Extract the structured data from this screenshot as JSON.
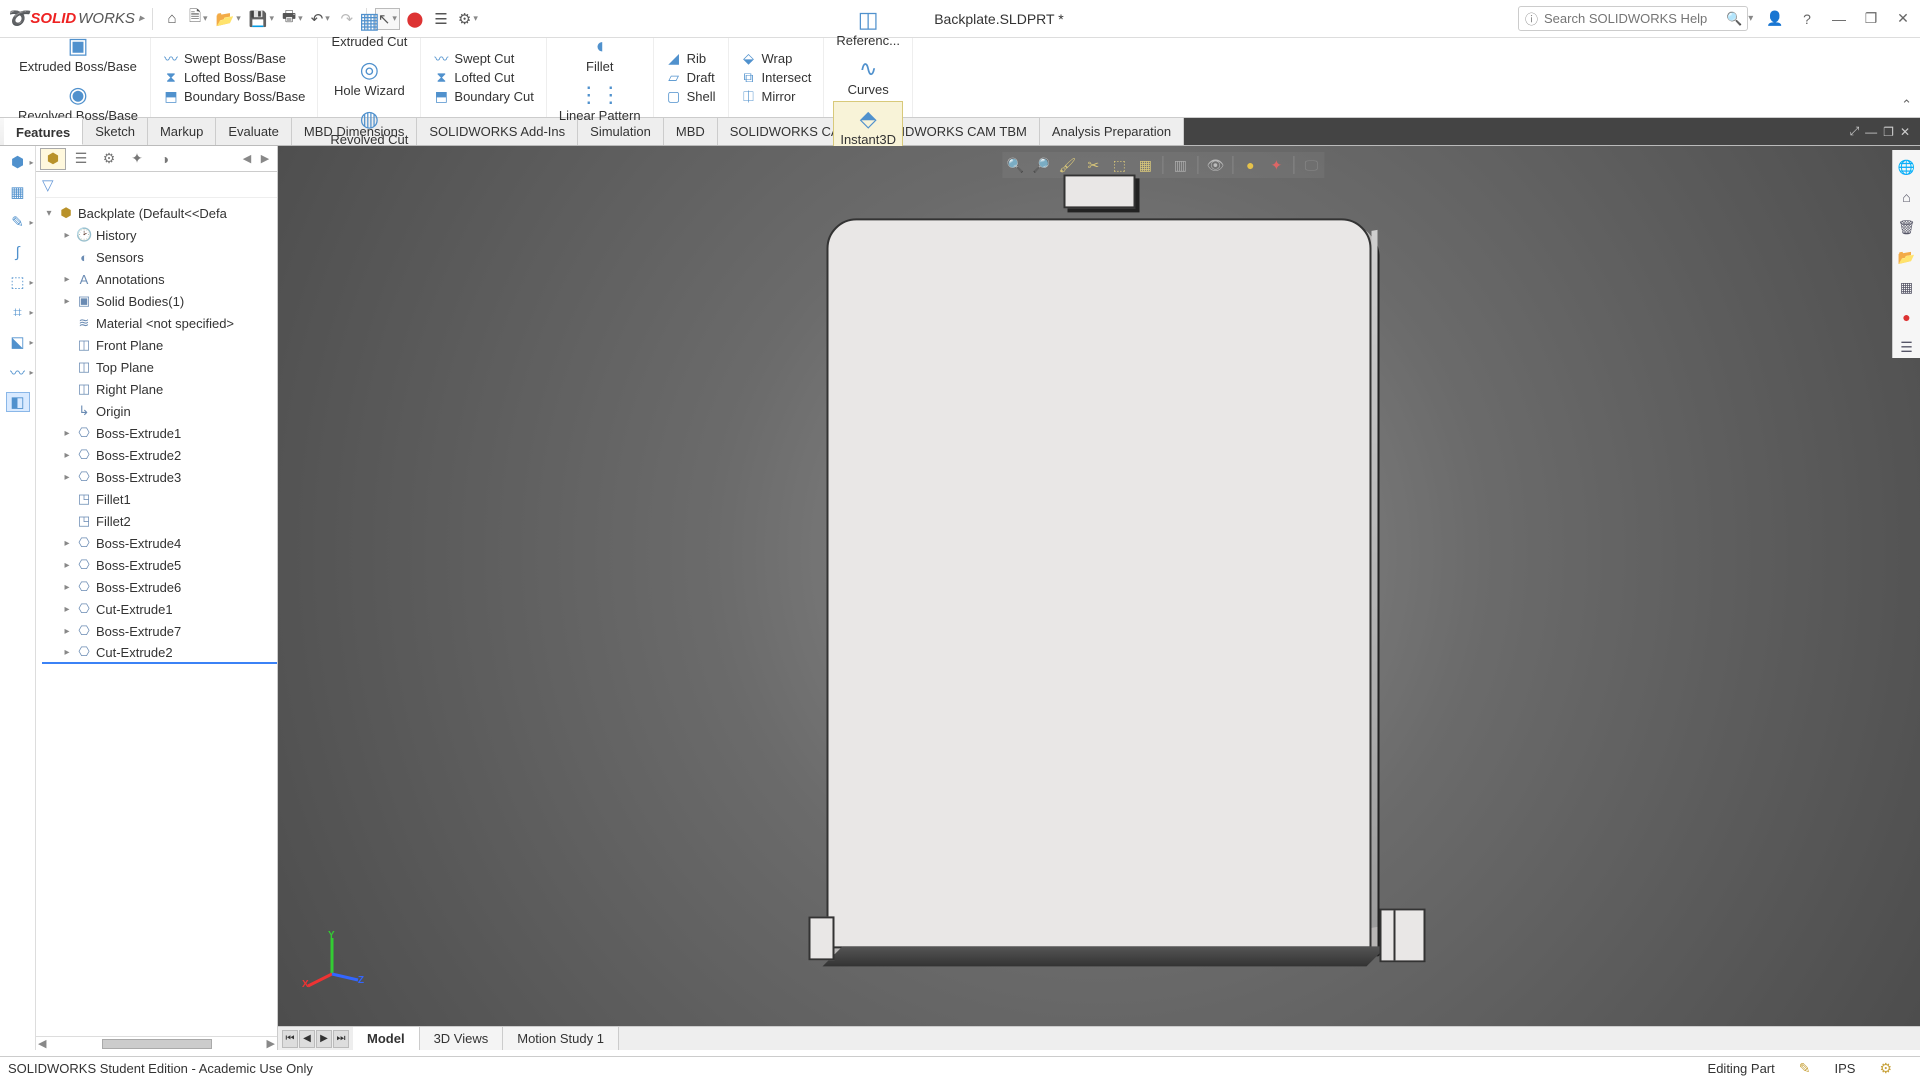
{
  "titlebar": {
    "brand_prefix": "SOLID",
    "brand_suffix": "WORKS",
    "doc_title": "Backplate.SLDPRT *",
    "search_placeholder": "Search SOLIDWORKS Help"
  },
  "ribbon": {
    "extruded_boss": "Extruded Boss/Base",
    "revolved_boss": "Revolved Boss/Base",
    "swept_boss": "Swept Boss/Base",
    "lofted_boss": "Lofted Boss/Base",
    "boundary_boss": "Boundary Boss/Base",
    "extruded_cut": "Extruded Cut",
    "hole_wizard": "Hole Wizard",
    "revolved_cut": "Revolved Cut",
    "swept_cut": "Swept Cut",
    "lofted_cut": "Lofted Cut",
    "boundary_cut": "Boundary Cut",
    "fillet": "Fillet",
    "linear_pattern": "Linear Pattern",
    "rib": "Rib",
    "draft": "Draft",
    "shell": "Shell",
    "wrap": "Wrap",
    "intersect": "Intersect",
    "mirror": "Mirror",
    "ref_geom": "Referenc...",
    "curves": "Curves",
    "instant3d": "Instant3D"
  },
  "tabs": {
    "items": [
      "Features",
      "Sketch",
      "Markup",
      "Evaluate",
      "MBD Dimensions",
      "SOLIDWORKS Add-Ins",
      "Simulation",
      "MBD",
      "SOLIDWORKS CAM",
      "SOLIDWORKS CAM TBM",
      "Analysis Preparation"
    ],
    "active_index": 0
  },
  "feature_tree": {
    "root": "Backplate  (Default<<Defa",
    "items": [
      {
        "label": "History",
        "icon": "🕑",
        "exp": "▸"
      },
      {
        "label": "Sensors",
        "icon": "◐",
        "exp": ""
      },
      {
        "label": "Annotations",
        "icon": "A",
        "exp": "▸"
      },
      {
        "label": "Solid Bodies(1)",
        "icon": "▣",
        "exp": "▸"
      },
      {
        "label": "Material <not specified>",
        "icon": "≋",
        "exp": ""
      },
      {
        "label": "Front Plane",
        "icon": "◫",
        "exp": ""
      },
      {
        "label": "Top Plane",
        "icon": "◫",
        "exp": ""
      },
      {
        "label": "Right Plane",
        "icon": "◫",
        "exp": ""
      },
      {
        "label": "Origin",
        "icon": "↳",
        "exp": ""
      },
      {
        "label": "Boss-Extrude1",
        "icon": "⎔",
        "exp": "▸"
      },
      {
        "label": "Boss-Extrude2",
        "icon": "⎔",
        "exp": "▸"
      },
      {
        "label": "Boss-Extrude3",
        "icon": "⎔",
        "exp": "▸"
      },
      {
        "label": "Fillet1",
        "icon": "◳",
        "exp": ""
      },
      {
        "label": "Fillet2",
        "icon": "◳",
        "exp": ""
      },
      {
        "label": "Boss-Extrude4",
        "icon": "⎔",
        "exp": "▸"
      },
      {
        "label": "Boss-Extrude5",
        "icon": "⎔",
        "exp": "▸"
      },
      {
        "label": "Boss-Extrude6",
        "icon": "⎔",
        "exp": "▸"
      },
      {
        "label": "Cut-Extrude1",
        "icon": "⎔",
        "exp": "▸"
      },
      {
        "label": "Boss-Extrude7",
        "icon": "⎔",
        "exp": "▸"
      },
      {
        "label": "Cut-Extrude2",
        "icon": "⎔",
        "exp": "▸"
      }
    ]
  },
  "bottom_tabs": {
    "items": [
      "Model",
      "3D Views",
      "Motion Study 1"
    ],
    "active_index": 0
  },
  "status": {
    "left": "SOLIDWORKS Student Edition - Academic Use Only",
    "mode": "Editing Part",
    "units": "IPS"
  },
  "triad": {
    "x": "X",
    "y": "Y",
    "z": "Z"
  }
}
